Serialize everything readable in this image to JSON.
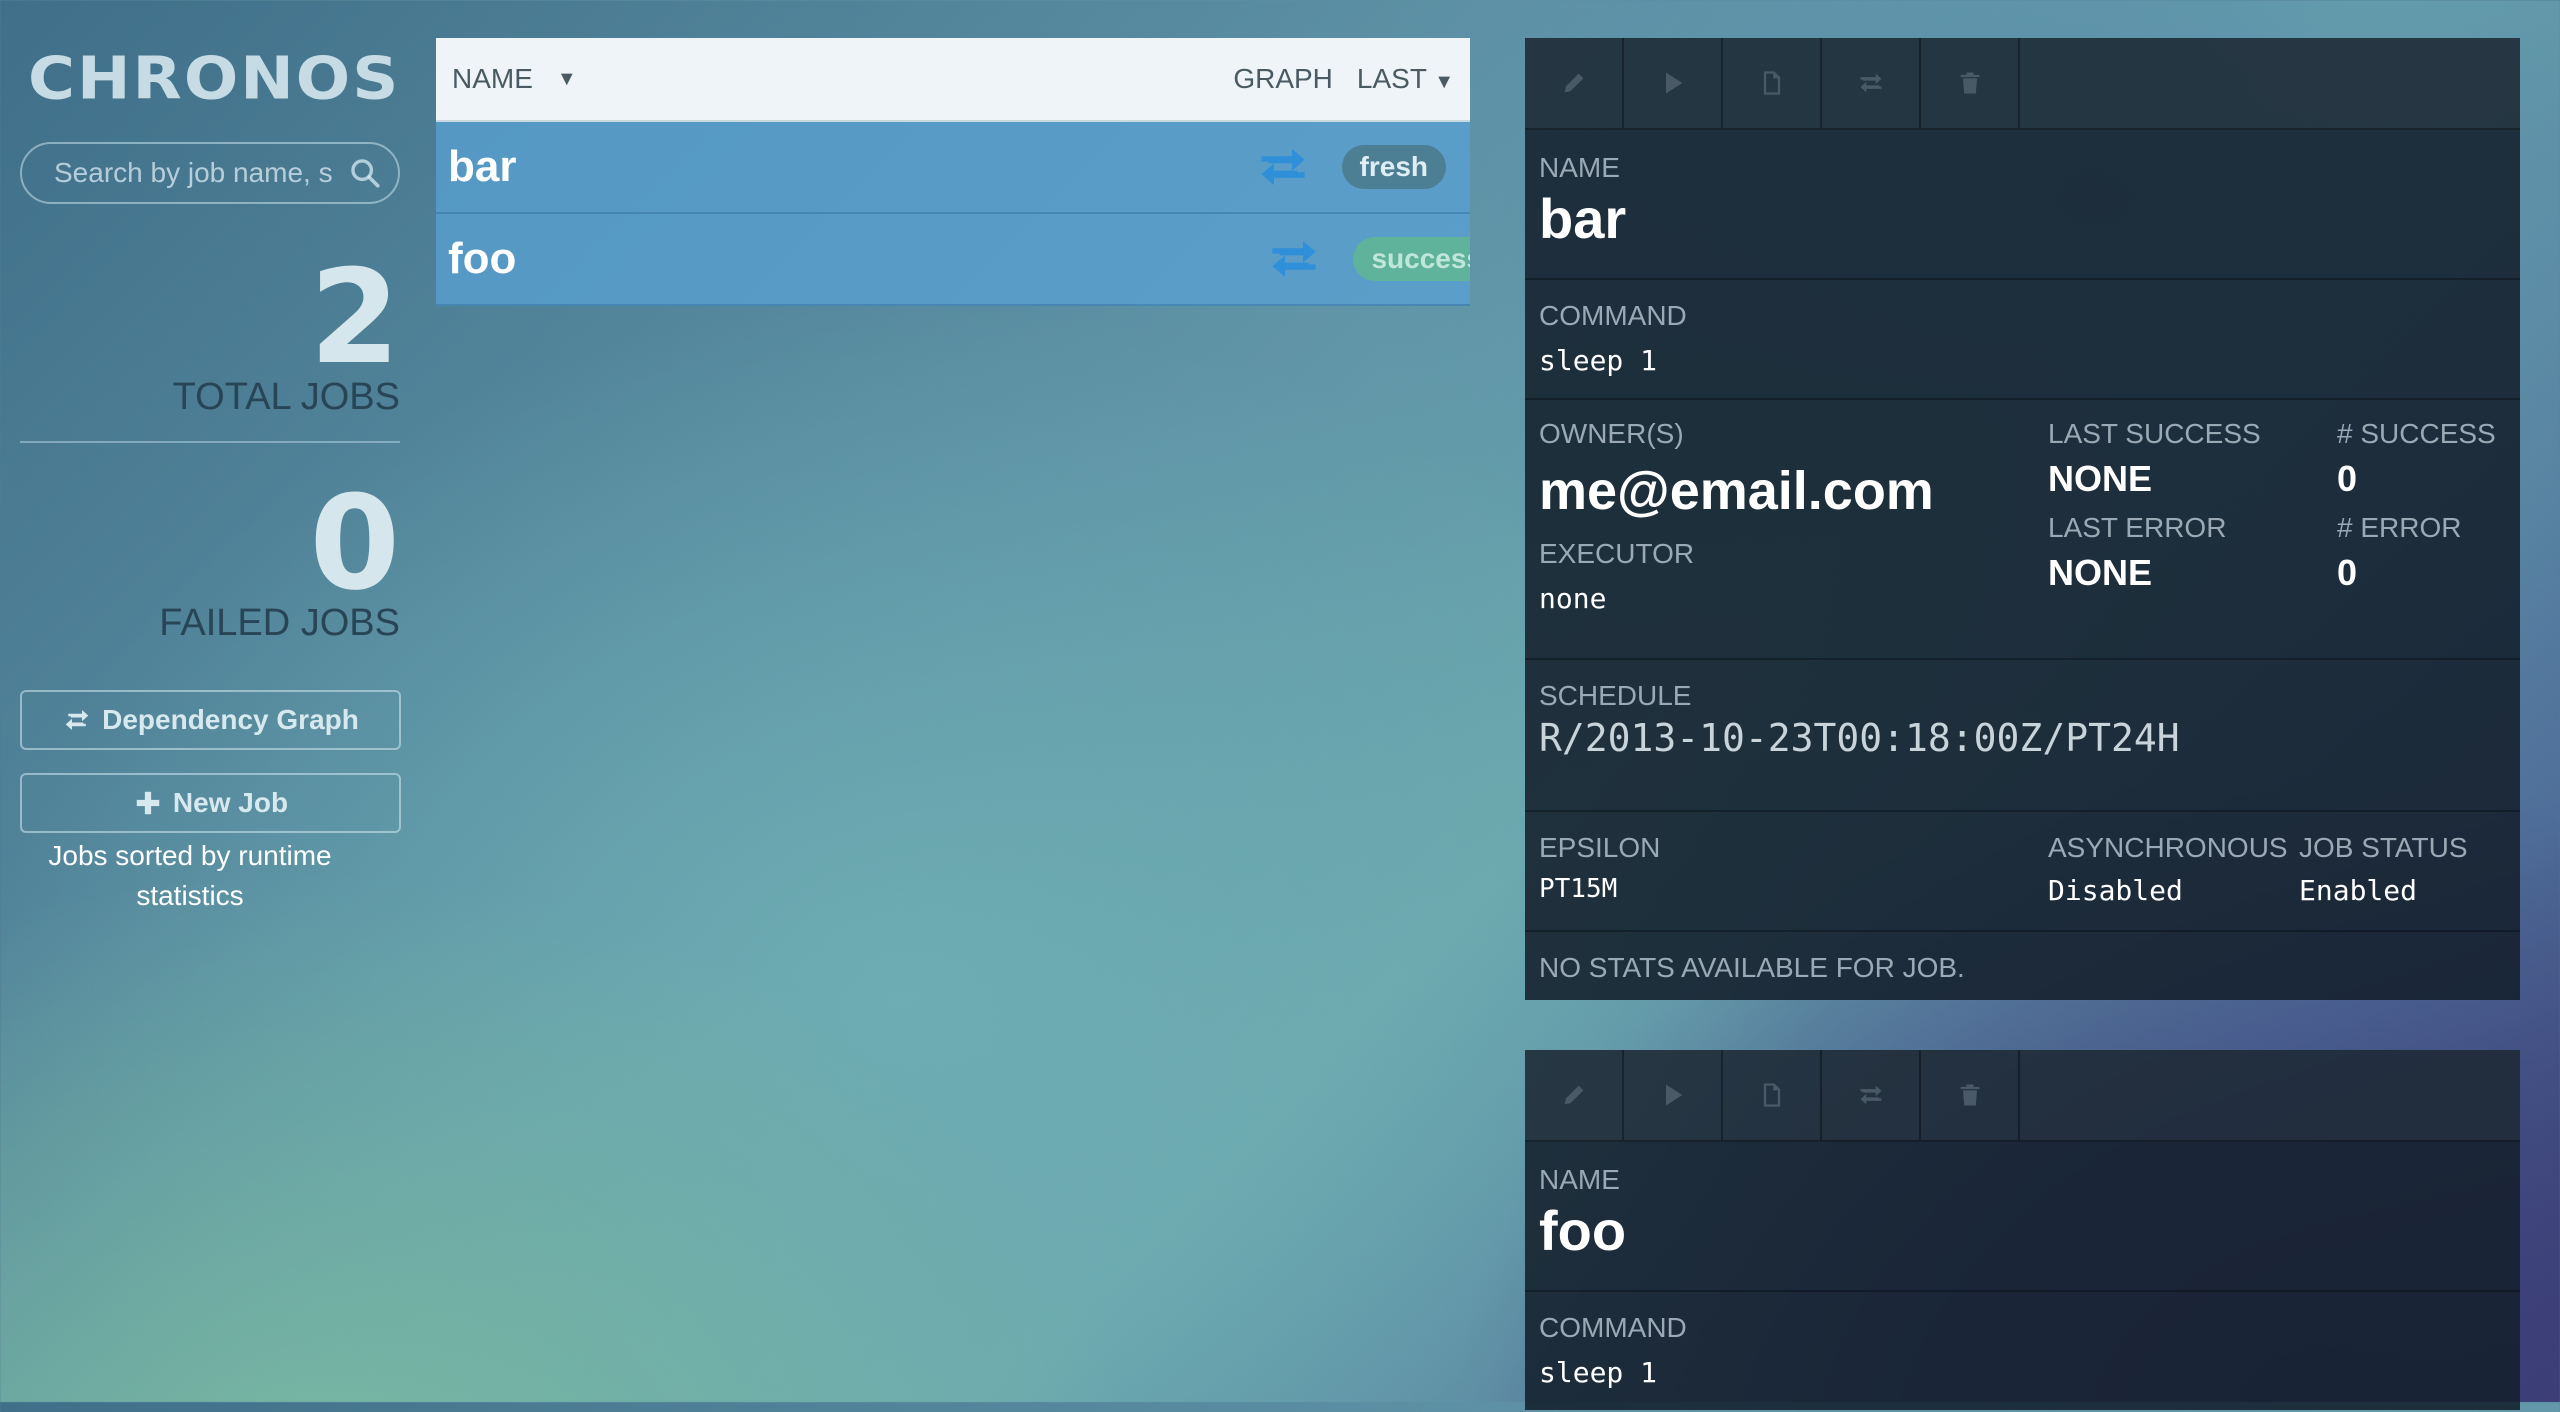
{
  "sidebar": {
    "logo": "CHRONOS",
    "search_placeholder": "Search by job name, s",
    "total_jobs_value": "2",
    "total_jobs_label": "TOTAL JOBS",
    "failed_jobs_value": "0",
    "failed_jobs_label": "FAILED JOBS",
    "dependency_graph_label": "Dependency Graph",
    "new_job_label": "New Job",
    "sort_note": "Jobs sorted by runtime statistics"
  },
  "job_list": {
    "columns": {
      "name": "NAME",
      "graph": "GRAPH",
      "last": "LAST"
    },
    "sort_caret": "▼",
    "rows": [
      {
        "name": "bar",
        "status": "fresh"
      },
      {
        "name": "foo",
        "status": "success"
      }
    ]
  },
  "details": [
    {
      "name_label": "NAME",
      "name": "bar",
      "command_label": "COMMAND",
      "command": "sleep 1",
      "owners_label": "OWNER(S)",
      "owners": "me@email.com",
      "executor_label": "EXECUTOR",
      "executor": "none",
      "last_success_label": "LAST SUCCESS",
      "last_success": "NONE",
      "success_count_label": "# SUCCESS",
      "success_count": "0",
      "last_error_label": "LAST ERROR",
      "last_error": "NONE",
      "error_count_label": "# ERROR",
      "error_count": "0",
      "schedule_label": "SCHEDULE",
      "schedule": "R/2013-10-23T00:18:00Z/PT24H",
      "epsilon_label": "EPSILON",
      "epsilon": "PT15M",
      "async_label": "ASYNCHRONOUS",
      "async": "Disabled",
      "job_status_label": "JOB STATUS",
      "job_status": "Enabled",
      "stats_note": "NO STATS AVAILABLE FOR JOB."
    },
    {
      "name_label": "NAME",
      "name": "foo",
      "command_label": "COMMAND",
      "command": "sleep 1"
    }
  ],
  "toolbar_icons": [
    "pencil-icon",
    "play-icon",
    "file-icon",
    "retweet-icon",
    "trash-icon"
  ],
  "colors": {
    "row_bg": "#58a0d2",
    "fresh_badge": "#4d7f94",
    "success_badge": "#5fb39a",
    "card_bg": "#14202c",
    "graph_icon": "#2f8fd8"
  }
}
